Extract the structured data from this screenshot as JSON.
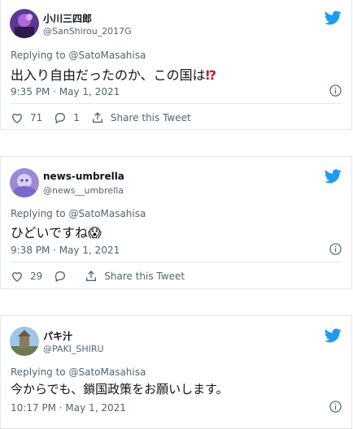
{
  "tweets": [
    {
      "name": "小川三四郎",
      "handle": "@SanShirou_2017G",
      "replying": "Replying to @SatoMasahisa",
      "text": "出入り自由だったのか、この国は",
      "emoji": "⁉",
      "time": "9:35 PM · May 1, 2021",
      "likes": "71",
      "replies": "1",
      "share": "Share this Tweet"
    },
    {
      "name": "news-umbrella",
      "handle": "@news__umbrella",
      "replying": "Replying to @SatoMasahisa",
      "text": "ひどいですね",
      "emoji": "😱",
      "time": "9:38 PM · May 1, 2021",
      "likes": "29",
      "share": "Share this Tweet"
    },
    {
      "name": "パキ汁",
      "handle": "@PAKI_SHIRU",
      "replying": "Replying to @SatoMasahisa",
      "text": "今からでも、鎖国政策をお願いします。",
      "time": "10:17 PM · May 1, 2021"
    }
  ],
  "colors": {
    "twitter_blue": "#1d9bf0",
    "muted": "#536471"
  },
  "icons": [
    "twitter-bird-icon",
    "info-icon",
    "heart-icon",
    "reply-icon",
    "share-icon"
  ]
}
